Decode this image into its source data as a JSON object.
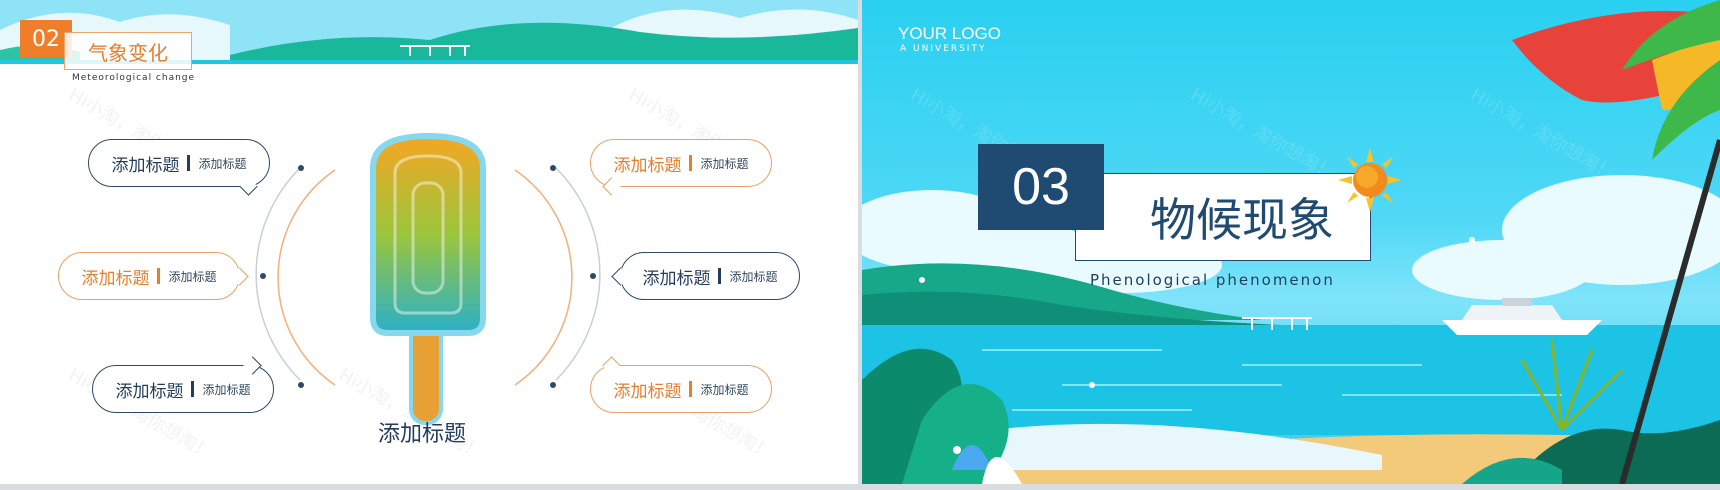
{
  "left_slide": {
    "section_number": "02",
    "section_title": "气象变化",
    "section_subtitle": "Meteorological change",
    "center_caption": "添加标题",
    "bubbles": [
      {
        "title": "添加标题",
        "sub": "添加标题"
      },
      {
        "title": "添加标题",
        "sub": "添加标题"
      },
      {
        "title": "添加标题",
        "sub": "添加标题"
      },
      {
        "title": "添加标题",
        "sub": "添加标题"
      },
      {
        "title": "添加标题",
        "sub": "添加标题"
      },
      {
        "title": "添加标题",
        "sub": "添加标题"
      }
    ],
    "watermark": "Hi小淘，淘你想淘！"
  },
  "right_slide": {
    "logo_title": "YOUR LOGO",
    "logo_subtitle": "A UNIVERSITY",
    "section_number": "03",
    "section_title": "物候现象",
    "section_subtitle": "Phenological phenomenon",
    "watermark": "Hi小淘，淘你想淘！"
  },
  "colors": {
    "accent_orange": "#e67e2e",
    "navy": "#1f4a72",
    "sky": "#2ad0f0",
    "teal": "#16a58a"
  }
}
